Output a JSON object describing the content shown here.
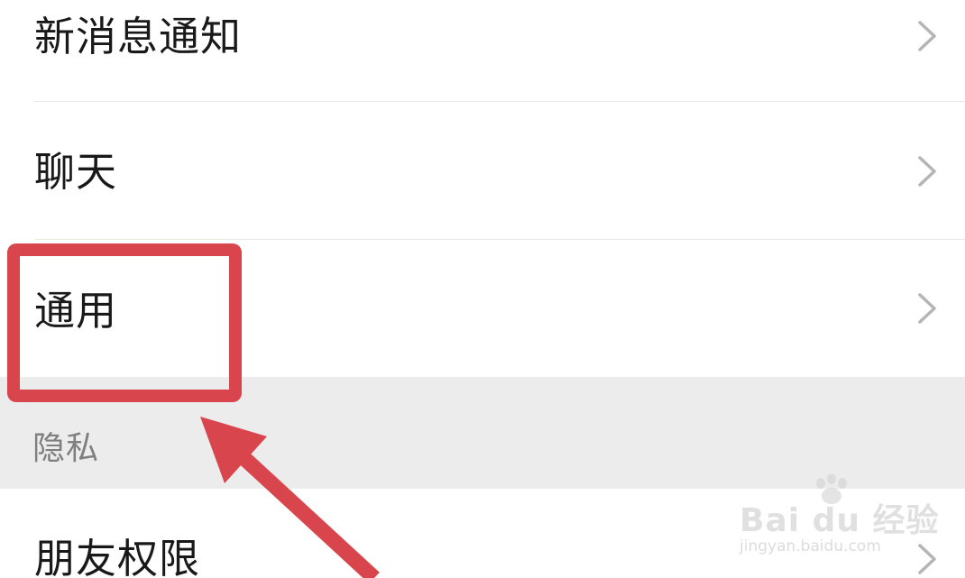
{
  "settings": {
    "items": [
      {
        "label": "新消息通知",
        "icon": "chevron-right-icon"
      },
      {
        "label": "聊天",
        "icon": "chevron-right-icon"
      },
      {
        "label": "通用",
        "icon": "chevron-right-icon"
      }
    ],
    "privacy_section": {
      "header": "隐私",
      "items": [
        {
          "label": "朋友权限",
          "icon": "chevron-right-icon"
        }
      ]
    }
  },
  "annotation": {
    "highlight_color": "#d9454d",
    "arrow_color": "#d9454d"
  },
  "watermark": {
    "brand": "Bai du 经验",
    "url": "jingyan.baidu.com"
  }
}
